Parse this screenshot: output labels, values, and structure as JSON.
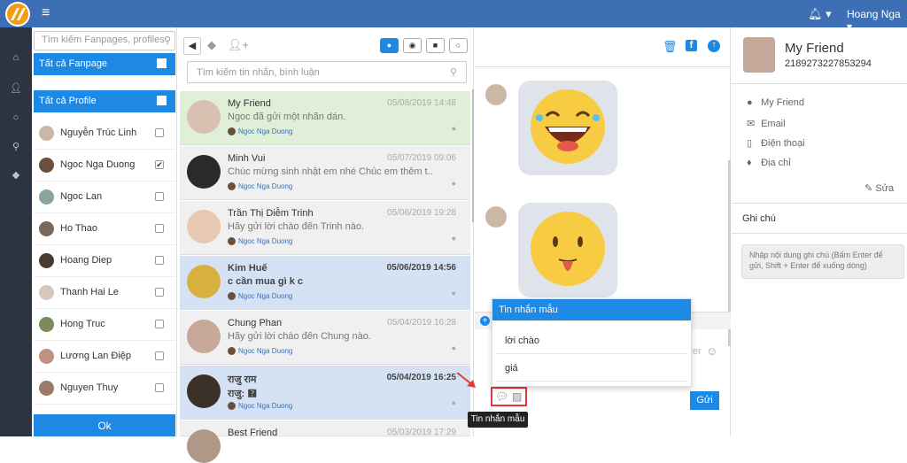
{
  "topbar": {
    "hamburger_icon": "menu-icon",
    "bell_icon": "bell-icon",
    "user_name": "Hoang Nga"
  },
  "left_icons": [
    "home-icon",
    "user-icon",
    "chat-icon",
    "paperclip-icon",
    "tags-icon"
  ],
  "profiles_panel": {
    "search_placeholder": "Tìm kiếm Fanpages, profiles",
    "all_fanpage": "Tất cả Fanpage",
    "all_profile": "Tất cả Profile",
    "profiles": [
      {
        "name": "Nguyễn Trúc Linh",
        "checked": ""
      },
      {
        "name": "Ngoc Nga Duong",
        "checked": "✔"
      },
      {
        "name": "Ngoc Lan",
        "checked": ""
      },
      {
        "name": "Ho Thao",
        "checked": ""
      },
      {
        "name": "Hoang Diep",
        "checked": ""
      },
      {
        "name": "Thanh Hai Le",
        "checked": ""
      },
      {
        "name": "Hong Truc",
        "checked": ""
      },
      {
        "name": "Lương Lan Điệp",
        "checked": ""
      },
      {
        "name": "Nguyen Thuy",
        "checked": ""
      }
    ],
    "ok_label": "Ok"
  },
  "conversations_panel": {
    "search_placeholder": "Tìm kiếm tin nhắn, bình luận",
    "items": [
      {
        "name": "My Friend",
        "time": "05/08/2019 14:48",
        "preview": "Ngoc đã gửi một nhãn dán.",
        "page": "Ngoc Nga Duong"
      },
      {
        "name": "Minh Vui",
        "time": "05/07/2019 09:06",
        "preview": "Chúc mừng sinh nhật em nhé Chúc em thêm t...",
        "page": "Ngoc Nga Duong"
      },
      {
        "name": "Trần Thị Diễm Trinh",
        "time": "05/06/2019 19:28",
        "preview": "Hãy gửi lời chào đến Trinh nào.",
        "page": "Ngoc Nga Duong"
      },
      {
        "name": "Kim Huế",
        "time": "05/06/2019 14:56",
        "preview": "c cần mua gì k c",
        "page": "Ngoc Nga Duong"
      },
      {
        "name": "Chung Phan",
        "time": "05/04/2019 16:28",
        "preview": "Hãy gửi lời chào đến Chung nào.",
        "page": "Ngoc Nga Duong"
      },
      {
        "name": "राजु राम",
        "time": "05/04/2019 16:25",
        "preview": "राजु: 🯄",
        "page": "Ngoc Nga Duong"
      },
      {
        "name": "Best Friend",
        "time": "05/03/2019 17:29",
        "preview": "",
        "page": ""
      }
    ]
  },
  "chat_panel": {
    "header_icons": [
      "trash-icon",
      "facebook-icon",
      "upload-icon"
    ],
    "input_hint": "er",
    "send_label": "Gửi",
    "tooltip": "Tin nhắn mẫu",
    "template_dropdown": {
      "title": "Tin nhắn mẫu",
      "items": [
        "lời chào",
        "giá"
      ]
    }
  },
  "contact_panel": {
    "name": "My Friend",
    "id": "2189273227853294",
    "fields": [
      {
        "icon": "user-icon",
        "label": "My Friend"
      },
      {
        "icon": "email-icon",
        "label": "Email"
      },
      {
        "icon": "phone-icon",
        "label": "Điện thoại"
      },
      {
        "icon": "location-icon",
        "label": "Địa chỉ"
      }
    ],
    "edit_label": "Sửa",
    "notes_title": "Ghi chú",
    "notes_placeholder": "Nhập nội dung ghi chú (Bấm Enter để gửi, Shift + Enter để xuống dòng)"
  }
}
